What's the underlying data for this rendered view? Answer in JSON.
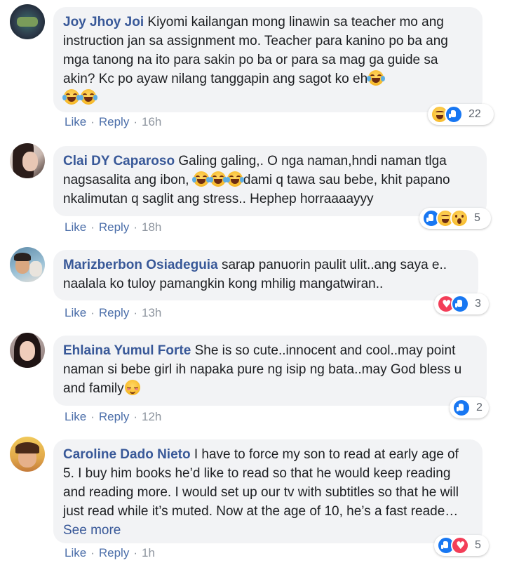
{
  "comments": [
    {
      "author": "Joy Jhoy Joi",
      "text": "Kiyomi kailangan mong linawin sa teacher mo ang instruction jan sa assignment mo. Teacher para kanino po ba ang mga tanong na ito para sakin po ba or para sa mag ga guide sa akin? Kc po ayaw nilang tanggapin ang sagot ko eh",
      "trailing_emoji": "😂😂",
      "like_label": "Like",
      "reply_label": "Reply",
      "time": "16h",
      "reactions": [
        "haha",
        "like"
      ],
      "reaction_count": "22"
    },
    {
      "author": "Clai DY Caparoso",
      "text_a": "Galing galing,. O nga naman,hndi naman tlga nagsasalita ang ibon,",
      "emoji_mid": "😂😂😂",
      "text_b": "dami q tawa sau bebe, khit papano nkalimutan q saglit ang stress.. Hephep horraaaayyy",
      "like_label": "Like",
      "reply_label": "Reply",
      "time": "18h",
      "reactions": [
        "like",
        "haha",
        "wow"
      ],
      "reaction_count": "5"
    },
    {
      "author": "Marizberbon Osiadeguia",
      "text": "sarap panuorin paulit ulit..ang saya e.. naalala ko tuloy pamangkin kong mhilig mangatwiran..",
      "like_label": "Like",
      "reply_label": "Reply",
      "time": "13h",
      "reactions": [
        "love",
        "like"
      ],
      "reaction_count": "3"
    },
    {
      "author": "Ehlaina Yumul Forte",
      "text": "She is so cute..innocent and cool..may point naman si bebe girl ih napaka pure ng isip ng bata..may God bless u and family",
      "trailing_emoji": "😊",
      "like_label": "Like",
      "reply_label": "Reply",
      "time": "12h",
      "reactions": [
        "like"
      ],
      "reaction_count": "2"
    },
    {
      "author": "Caroline Dado Nieto",
      "text": "I have to force my son to read at early age of 5. I buy him books he’d like to read so that he would keep reading and reading more. I would set up our tv with subtitles so that he will just read while it’s muted. Now at the age of 10, he’s a fast reade…",
      "see_more": "See more",
      "like_label": "Like",
      "reply_label": "Reply",
      "time": "1h",
      "reactions": [
        "like",
        "love"
      ],
      "reaction_count": "5"
    }
  ],
  "colors": {
    "author": "#385898",
    "bubble": "#f2f3f5",
    "action_link": "#4b6ea9",
    "time": "#8d949e",
    "like": "#1877f2",
    "love": "#f33e58",
    "haha": "#f7b928"
  }
}
